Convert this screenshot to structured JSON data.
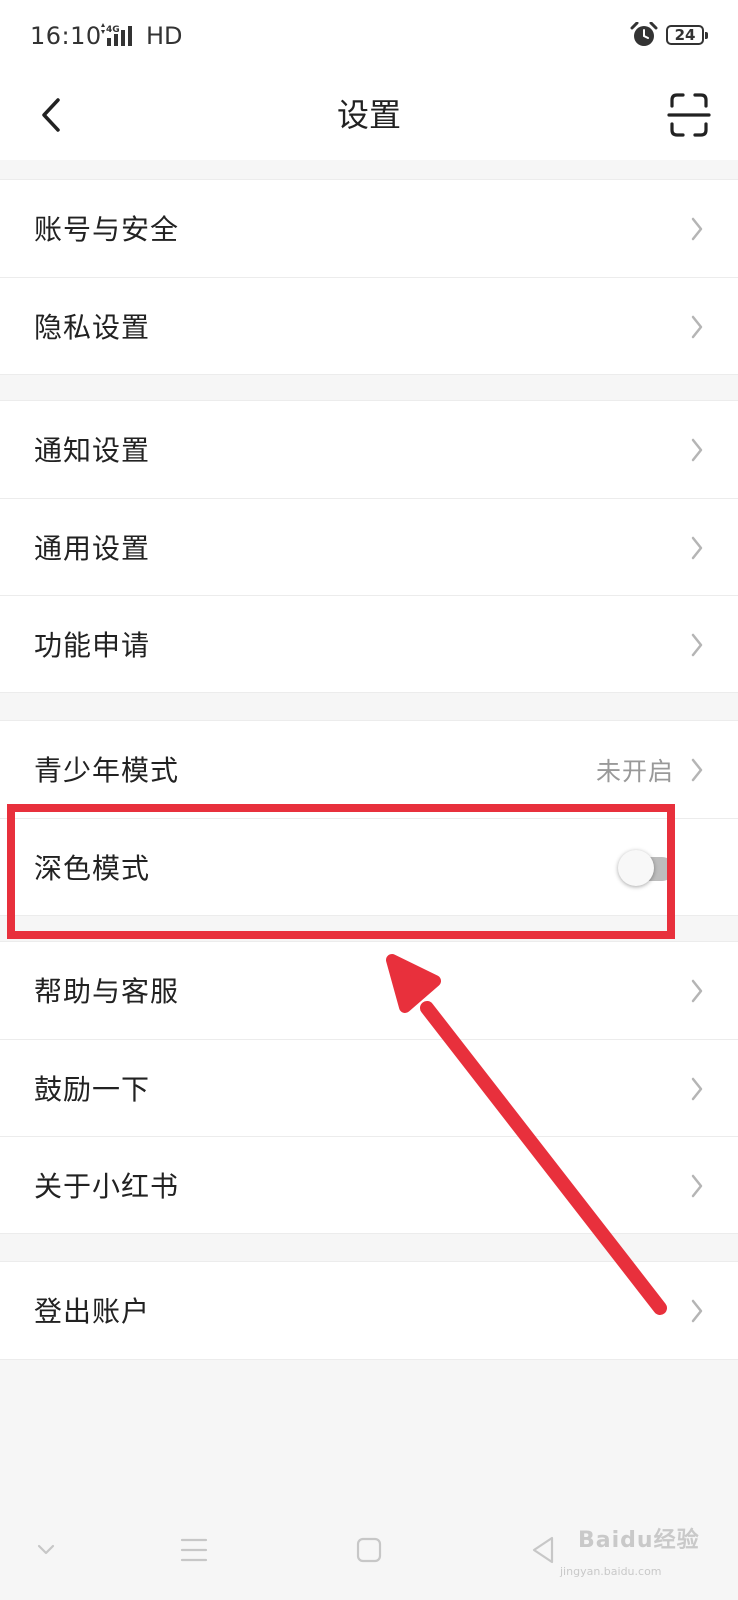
{
  "status_bar": {
    "time": "16:10",
    "network": "4G",
    "hd": "HD",
    "battery": "24"
  },
  "header": {
    "title": "设置",
    "back_icon": "chevron-left-icon",
    "scan_icon": "scan-icon"
  },
  "groups": [
    {
      "items": [
        {
          "label": "账号与安全"
        },
        {
          "label": "隐私设置"
        }
      ]
    },
    {
      "items": [
        {
          "label": "通知设置"
        },
        {
          "label": "通用设置"
        },
        {
          "label": "功能申请"
        }
      ]
    },
    {
      "items": [
        {
          "label": "青少年模式",
          "value": "未开启"
        },
        {
          "label": "深色模式",
          "toggle": false
        }
      ]
    },
    {
      "items": [
        {
          "label": "帮助与客服"
        },
        {
          "label": "鼓励一下"
        },
        {
          "label": "关于小红书"
        }
      ]
    },
    {
      "items": [
        {
          "label": "登出账户"
        }
      ]
    }
  ],
  "overlay": {
    "highlight_color": "#e8303c"
  },
  "watermark": {
    "text": "Baidu经验",
    "sub": "jingyan.baidu.com"
  }
}
